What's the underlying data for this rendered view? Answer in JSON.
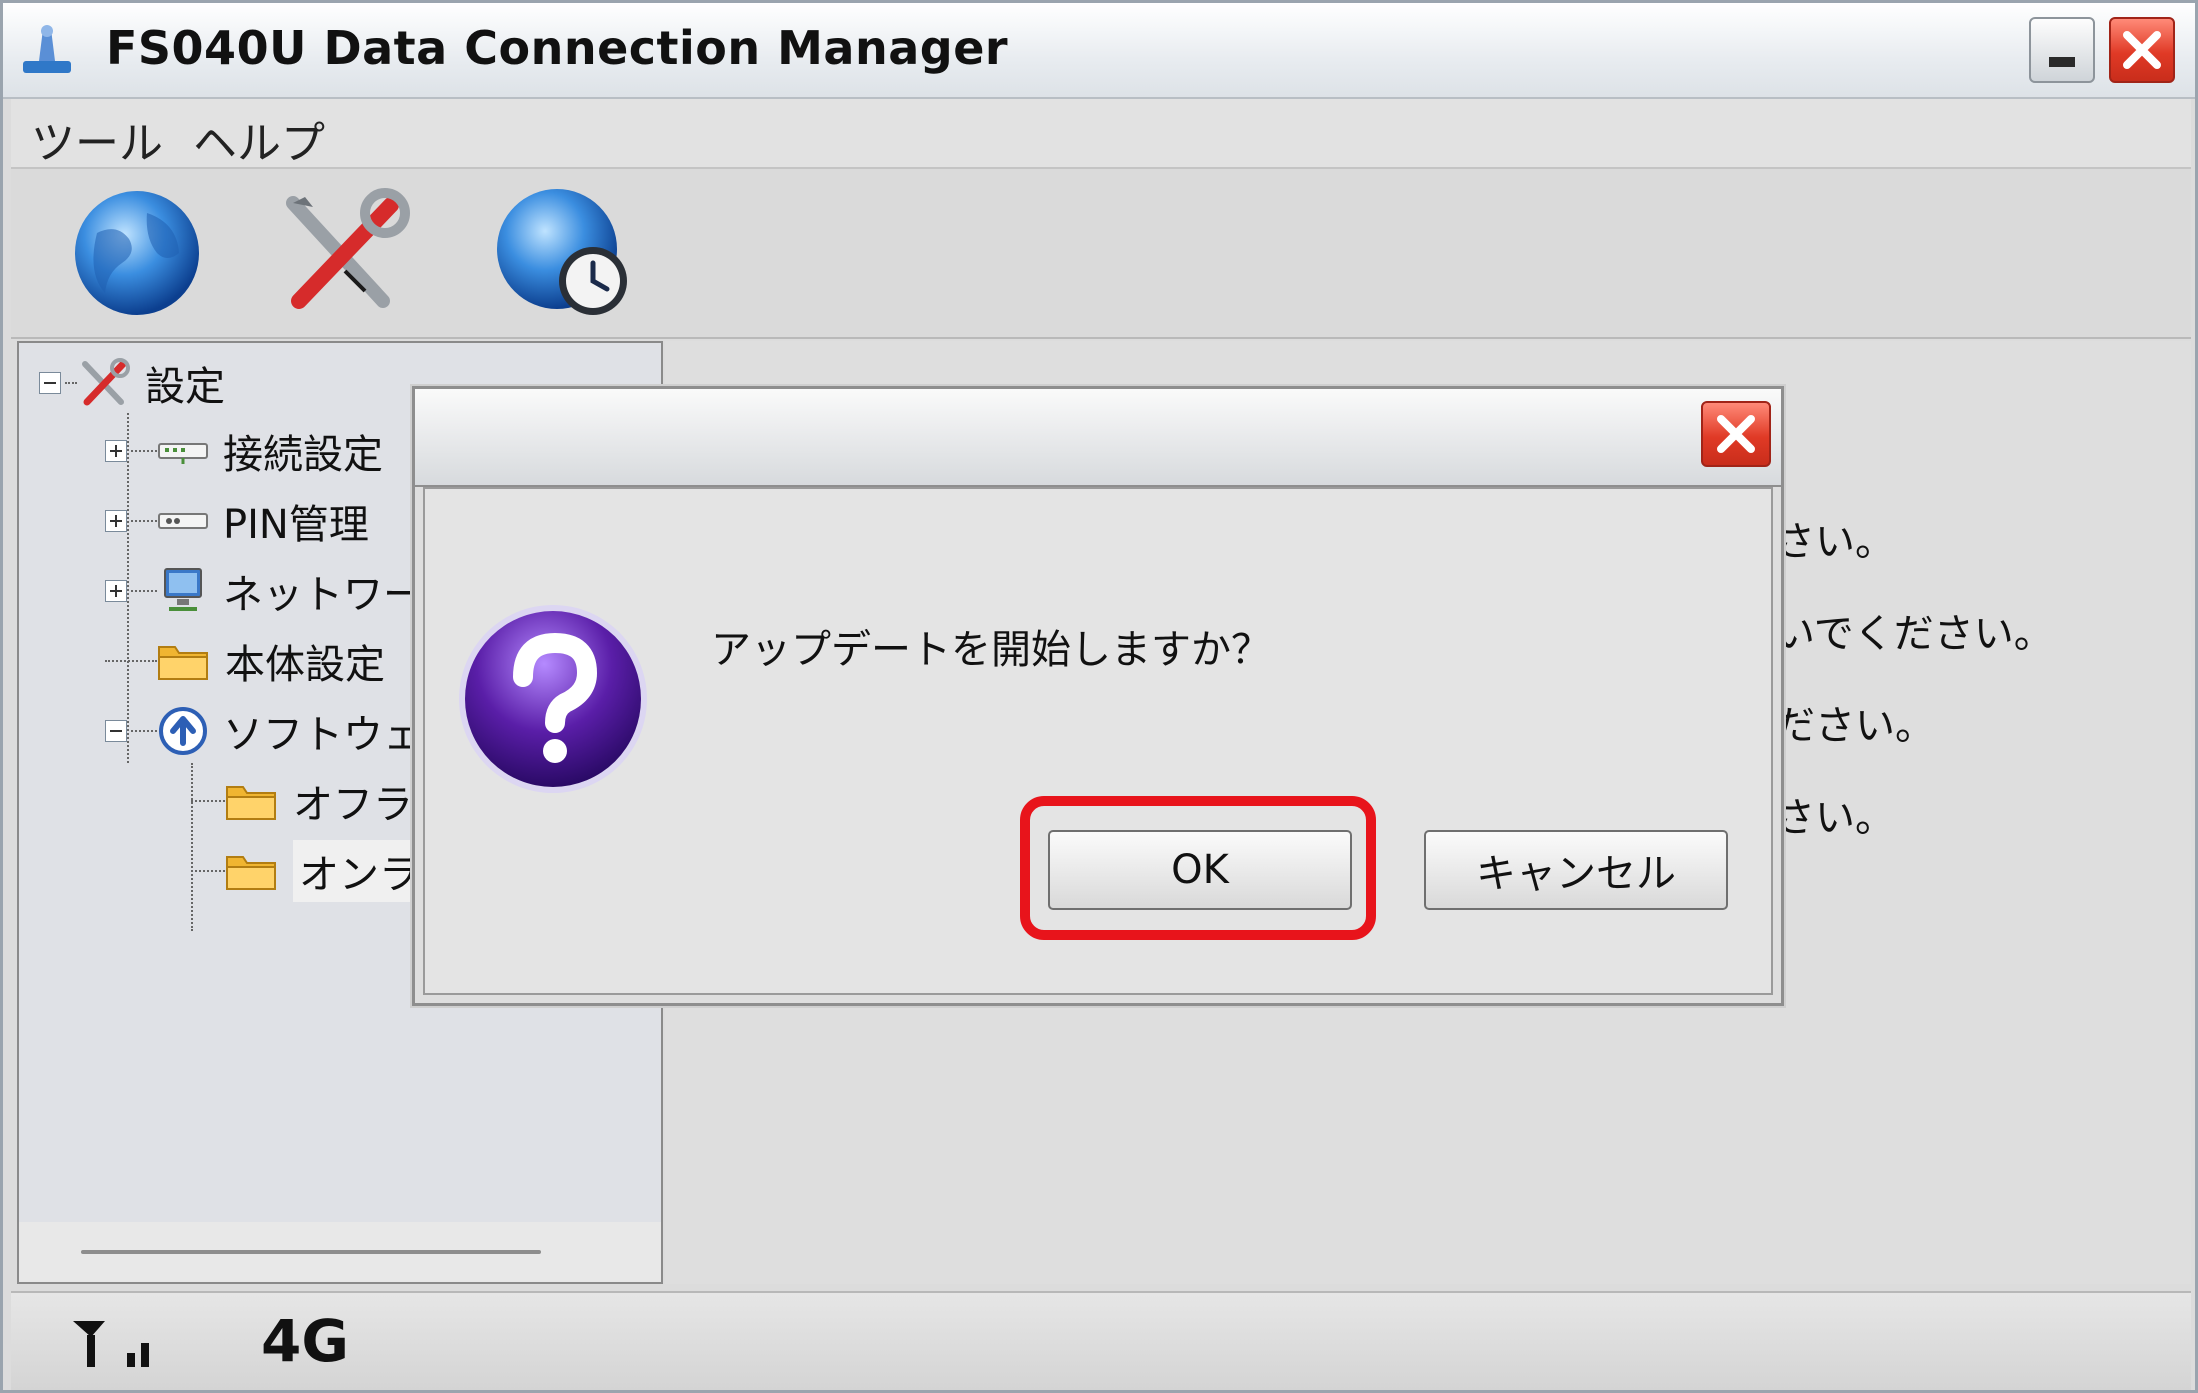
{
  "window": {
    "title": "FS040U Data Connection Manager",
    "title_buttons": [
      "minimize",
      "close"
    ]
  },
  "menu": {
    "items": [
      "ツール",
      "ヘルプ"
    ]
  },
  "toolbar": {
    "icons": [
      "globe-icon",
      "tools-icon",
      "globe-clock-icon"
    ]
  },
  "tree": {
    "root": "設定",
    "items": [
      {
        "label": "接続設定",
        "level": 1,
        "expander": "plus",
        "icon": "network-device-icon"
      },
      {
        "label": "PIN管理",
        "level": 1,
        "expander": "plus",
        "icon": "pin-device-icon"
      },
      {
        "label": "ネットワー",
        "level": 1,
        "expander": "plus",
        "icon": "computer-icon"
      },
      {
        "label": "本体設定",
        "level": 1,
        "expander": "none",
        "icon": "folder-icon"
      },
      {
        "label": "ソフトウェア",
        "level": 1,
        "expander": "minus",
        "icon": "upload-circle-icon"
      },
      {
        "label": "オフラ",
        "level": 2,
        "expander": "none",
        "icon": "folder-icon"
      },
      {
        "label": "オンラ",
        "level": 2,
        "expander": "none",
        "icon": "folder-icon",
        "selected": true
      }
    ]
  },
  "main": {
    "lines": [
      "さい。",
      "いでください。",
      "ださい。",
      "さい。"
    ]
  },
  "status": {
    "network_type": "4G",
    "signal_bars": 2
  },
  "dialog": {
    "message": "アップデートを開始しますか？",
    "ok_label": "OK",
    "cancel_label": "キャンセル",
    "highlight_color": "#e8141b"
  },
  "colors": {
    "close_button": "#e03a26",
    "question_icon": "#5a1ea8"
  }
}
